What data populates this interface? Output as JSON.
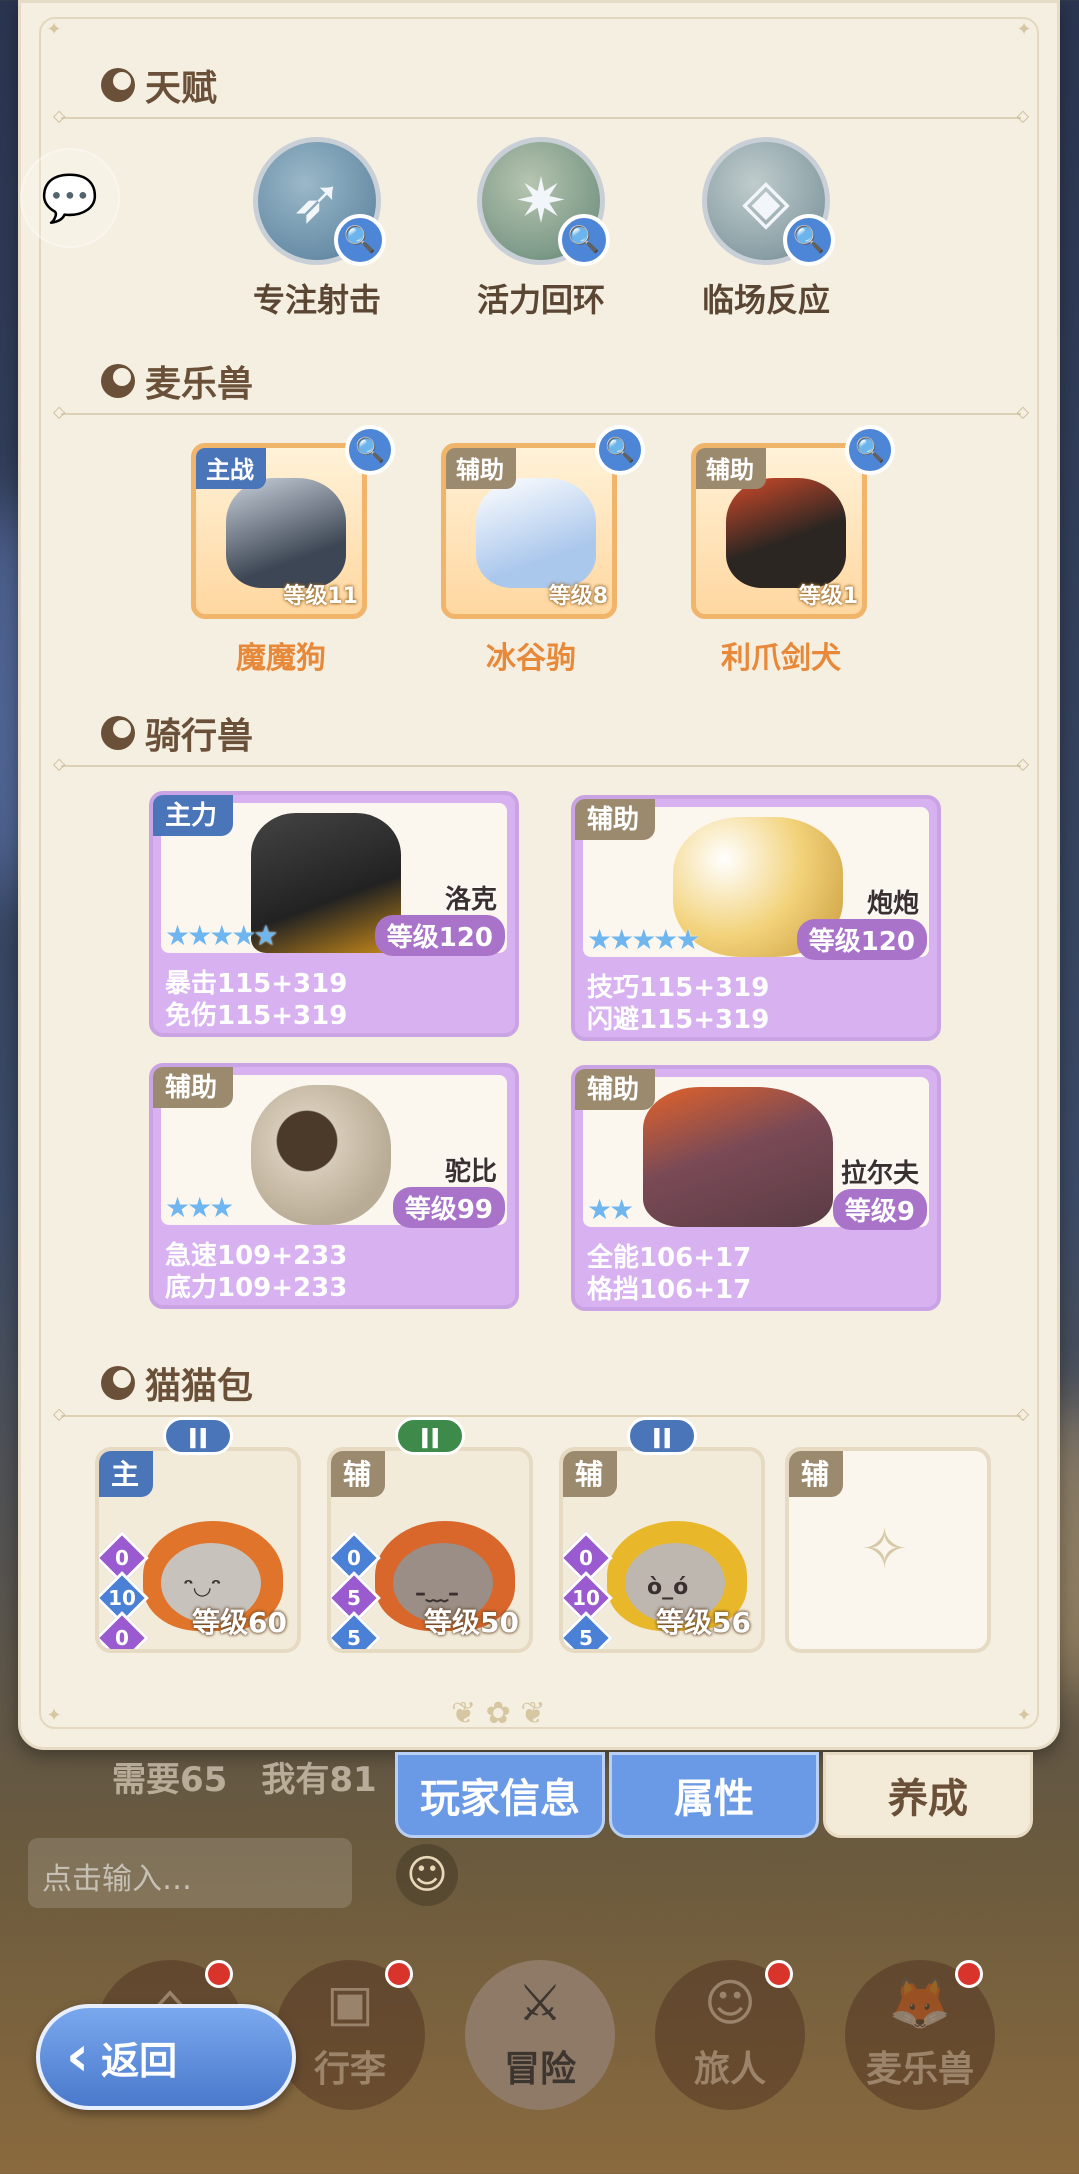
{
  "chat_icon": "chat-bubble-icon",
  "sections": {
    "talent_title": "天赋",
    "pet_title": "麦乐兽",
    "mount_title": "骑行兽",
    "cat_title": "猫猫包"
  },
  "talents": [
    {
      "name": "专注射击",
      "icon": "bow-icon"
    },
    {
      "name": "活力回环",
      "icon": "star-burst-icon"
    },
    {
      "name": "临场反应",
      "icon": "diamond-icon"
    }
  ],
  "pets": [
    {
      "tag": "主战",
      "level": "等级11",
      "name": "魔魔狗"
    },
    {
      "tag": "辅助",
      "level": "等级8",
      "name": "冰谷驹"
    },
    {
      "tag": "辅助",
      "level": "等级1",
      "name": "利爪剑犬"
    }
  ],
  "mounts": [
    {
      "tag": "主力",
      "name": "洛克",
      "level": "等级120",
      "stars": "★★★★★",
      "stat1": "暴击115+319",
      "stat2": "免伤115+319"
    },
    {
      "tag": "辅助",
      "name": "炮炮",
      "level": "等级120",
      "stars": "★★★★★",
      "stat1": "技巧115+319",
      "stat2": "闪避115+319"
    },
    {
      "tag": "辅助",
      "name": "驼比",
      "level": "等级99",
      "stars": "★★★",
      "stat1": "急速109+233",
      "stat2": "底力109+233"
    },
    {
      "tag": "辅助",
      "name": "拉尔夫",
      "level": "等级9",
      "stars": "★★",
      "stat1": "全能106+17",
      "stat2": "格挡106+17"
    }
  ],
  "cats": [
    {
      "tag": "主",
      "rank": "II",
      "level": "等级60",
      "gems": [
        "0",
        "10",
        "0"
      ],
      "face": "ᵔ◡ᵔ"
    },
    {
      "tag": "辅",
      "rank": "II",
      "level": "等级50",
      "gems": [
        "0",
        "5",
        "5"
      ],
      "face": "–﹏–"
    },
    {
      "tag": "辅",
      "rank": "II",
      "level": "等级56",
      "gems": [
        "0",
        "10",
        "5"
      ],
      "face": "ò_ó"
    },
    {
      "tag": "辅"
    }
  ],
  "below": {
    "need_text": "需要65　我有81",
    "input_placeholder": "点击输入…"
  },
  "tabs": [
    "玩家信息",
    "属性",
    "养成"
  ],
  "nav": [
    "行李",
    "冒险",
    "旅人",
    "麦乐兽"
  ],
  "back_label": "返回"
}
